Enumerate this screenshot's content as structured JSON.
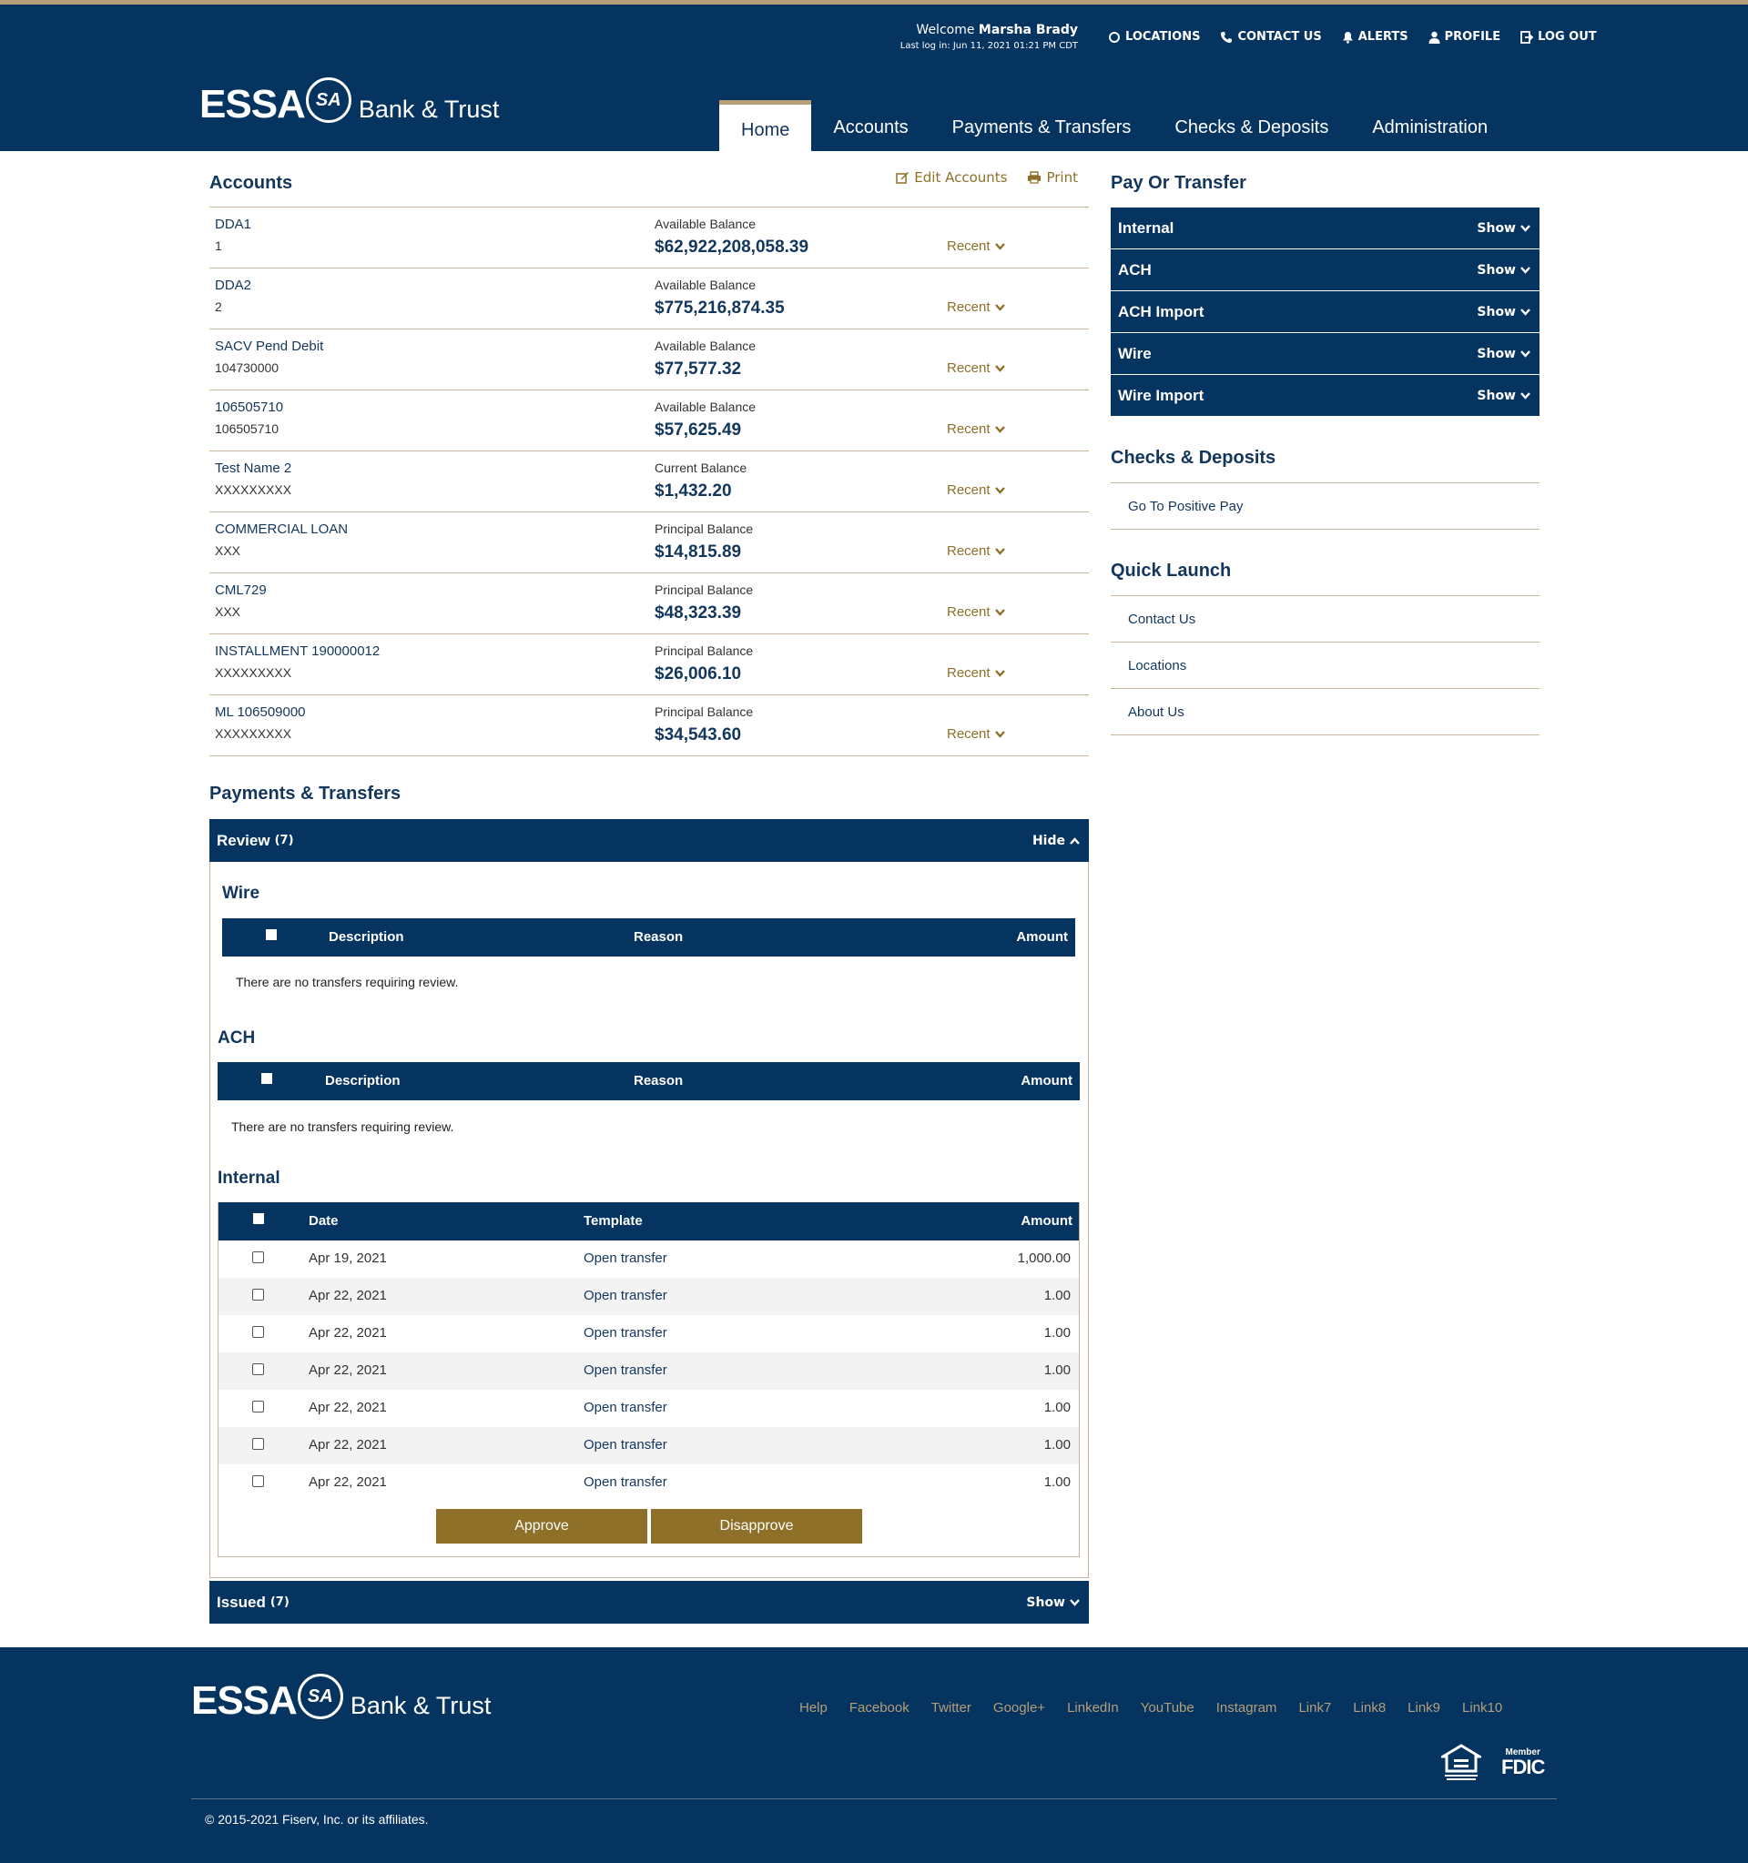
{
  "header": {
    "welcome_prefix": "Welcome",
    "user_name": "Marsha Brady",
    "last_login": "Last log in: Jun 11, 2021 01:21 PM CDT",
    "util": [
      "LOCATIONS",
      "CONTACT US",
      "ALERTS",
      "PROFILE",
      "LOG OUT"
    ],
    "logo_main": "ESSA",
    "logo_mark": "SA",
    "logo_sub": "Bank & Trust",
    "nav": [
      "Home",
      "Accounts",
      "Payments & Transfers",
      "Checks & Deposits",
      "Administration"
    ],
    "active_nav": "Home"
  },
  "accounts": {
    "title": "Accounts",
    "edit_label": "Edit Accounts",
    "print_label": "Print",
    "recent_label": "Recent",
    "rows": [
      {
        "name": "DDA1",
        "number": "1",
        "balance_label": "Available Balance",
        "balance": "$62,922,208,058.39"
      },
      {
        "name": "DDA2",
        "number": "2",
        "balance_label": "Available Balance",
        "balance": "$775,216,874.35"
      },
      {
        "name": "SACV Pend Debit",
        "number": "104730000",
        "balance_label": "Available Balance",
        "balance": "$77,577.32"
      },
      {
        "name": "106505710",
        "number": "106505710",
        "balance_label": "Available Balance",
        "balance": "$57,625.49"
      },
      {
        "name": "Test Name 2",
        "number": "XXXXXXXXX",
        "balance_label": "Current Balance",
        "balance": "$1,432.20"
      },
      {
        "name": "COMMERCIAL LOAN",
        "number": "XXX",
        "balance_label": "Principal Balance",
        "balance": "$14,815.89"
      },
      {
        "name": "CML729",
        "number": "XXX",
        "balance_label": "Principal Balance",
        "balance": "$48,323.39"
      },
      {
        "name": "INSTALLMENT 190000012",
        "number": "XXXXXXXXX",
        "balance_label": "Principal Balance",
        "balance": "$26,006.10"
      },
      {
        "name": "ML 106509000",
        "number": "XXXXXXXXX",
        "balance_label": "Principal Balance",
        "balance": "$34,543.60"
      }
    ]
  },
  "payments": {
    "title": "Payments & Transfers",
    "review": {
      "label": "Review",
      "count": "(7)",
      "toggle": "Hide"
    },
    "wire": {
      "title": "Wire",
      "columns": [
        "Description",
        "Reason",
        "Amount"
      ],
      "empty": "There are no transfers requiring review."
    },
    "ach": {
      "title": "ACH",
      "columns": [
        "Description",
        "Reason",
        "Amount"
      ],
      "empty": "There are no transfers requiring review."
    },
    "internal": {
      "title": "Internal",
      "columns": [
        "Date",
        "Template",
        "Amount"
      ],
      "rows": [
        {
          "date": "Apr 19, 2021",
          "template": "Open transfer",
          "amount": "1,000.00"
        },
        {
          "date": "Apr 22, 2021",
          "template": "Open transfer",
          "amount": "1.00"
        },
        {
          "date": "Apr 22, 2021",
          "template": "Open transfer",
          "amount": "1.00"
        },
        {
          "date": "Apr 22, 2021",
          "template": "Open transfer",
          "amount": "1.00"
        },
        {
          "date": "Apr 22, 2021",
          "template": "Open transfer",
          "amount": "1.00"
        },
        {
          "date": "Apr 22, 2021",
          "template": "Open transfer",
          "amount": "1.00"
        },
        {
          "date": "Apr 22, 2021",
          "template": "Open transfer",
          "amount": "1.00"
        }
      ]
    },
    "approve_label": "Approve",
    "disapprove_label": "Disapprove",
    "issued": {
      "label": "Issued",
      "count": "(7)",
      "toggle": "Show"
    }
  },
  "right": {
    "pay_title": "Pay Or Transfer",
    "pay_items": [
      "Internal",
      "ACH",
      "ACH Import",
      "Wire",
      "Wire Import"
    ],
    "show_label": "Show",
    "checks_title": "Checks & Deposits",
    "checks_items": [
      "Go To Positive Pay"
    ],
    "quick_title": "Quick Launch",
    "quick_items": [
      "Contact Us",
      "Locations",
      "About Us"
    ]
  },
  "footer": {
    "links": [
      "Help",
      "Facebook",
      "Twitter",
      "Google+",
      "LinkedIn",
      "YouTube",
      "Instagram",
      "Link7",
      "Link8",
      "Link9",
      "Link10"
    ],
    "fdic_member": "Member",
    "fdic": "FDIC",
    "copyright": "© 2015-2021 Fiserv, Inc. or its affiliates."
  },
  "colors": {
    "navy": "#063460",
    "gold": "#8e7028",
    "rule": "#c6b79c"
  }
}
